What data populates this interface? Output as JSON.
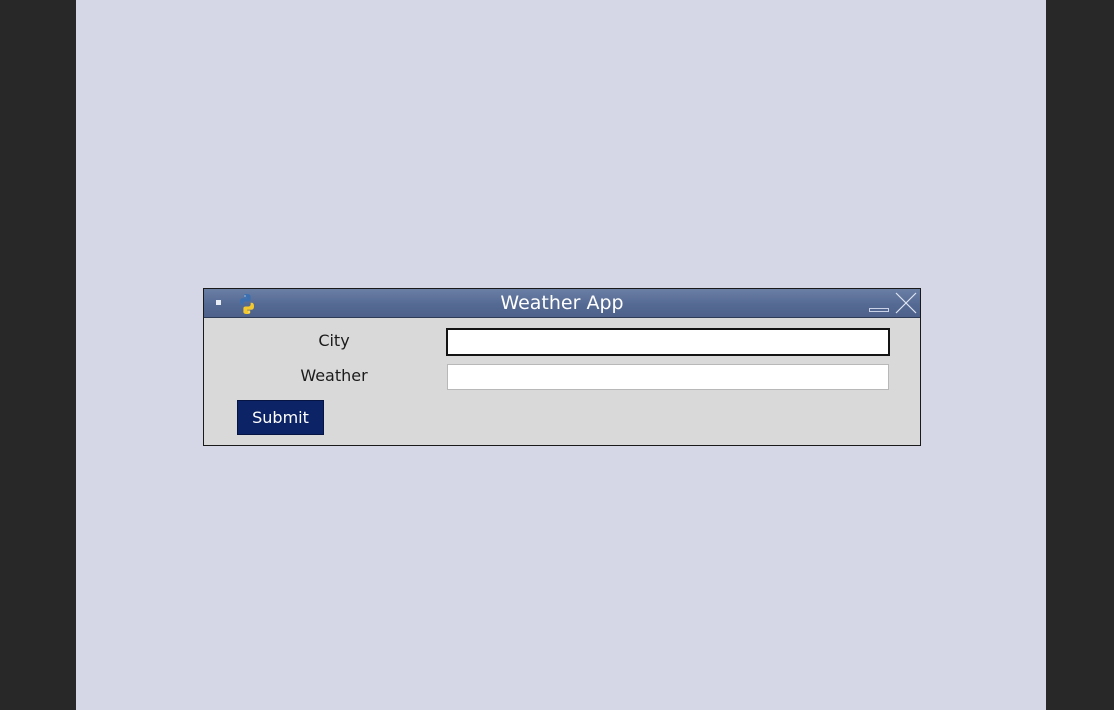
{
  "window": {
    "title": "Weather App",
    "titlebar_color": "#556a93",
    "body_color": "#d9d9d9"
  },
  "icons": {
    "menu": "window-menu-icon",
    "app": "python-icon",
    "minimize": "minimize-icon",
    "close": "close-icon"
  },
  "form": {
    "city_label": "City",
    "city_value": "",
    "weather_label": "Weather",
    "weather_value": "",
    "submit_label": "Submit",
    "submit_color": "#0c2366"
  },
  "desktop": {
    "background": "#d5d7e6"
  }
}
